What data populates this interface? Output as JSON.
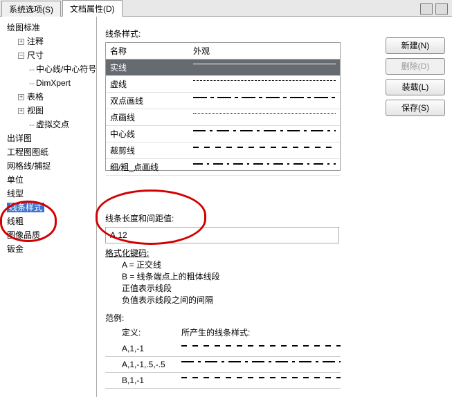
{
  "tabs": {
    "system": "系统选项(S)",
    "document": "文档属性(D)"
  },
  "tree": {
    "root": "绘图标准",
    "annotation": "注释",
    "dimension": "尺寸",
    "centerline": "中心线/中心符号线",
    "dimxpert": "DimXpert",
    "tables": "表格",
    "views": "视图",
    "virtual": "虚拟交点",
    "detail": "出详图",
    "drawing": "工程图图纸",
    "gridsnap": "网格线/捕捉",
    "units": "单位",
    "linetype": "线型",
    "linestyle": "线条样式",
    "lineweight": "线粗",
    "imgqual": "图像品质",
    "sheetmetal": "钣金"
  },
  "main": {
    "styleLabel": "线条样式:",
    "col_name": "名称",
    "col_appearance": "外观",
    "rows": {
      "solid": "实线",
      "dashed": "虚线",
      "twodot": "双点画线",
      "dotdash": "点画线",
      "center": "中心线",
      "trim": "裁剪线",
      "thinthick": "细/粗_点画线"
    },
    "lengthLabel": "线条长度和间距值:",
    "lengthValue": "A,12",
    "fmtLabel": "格式化键码:",
    "fmtA": "A = 正交线",
    "fmtB": "B = 线条端点上的粗体线段",
    "fmtPos": "正值表示线段",
    "fmtNeg": "负值表示线段之间的间隔",
    "exLabel": "范例:",
    "exDef": "定义:",
    "exRes": "所产生的线条样式:",
    "ex1": "A,1,-1",
    "ex2": "A,1,-1,.5,-.5",
    "ex3": "B,1,-1"
  },
  "buttons": {
    "new": "新建(N)",
    "delete": "删除(D)",
    "load": "装载(L)",
    "save": "保存(S)"
  }
}
